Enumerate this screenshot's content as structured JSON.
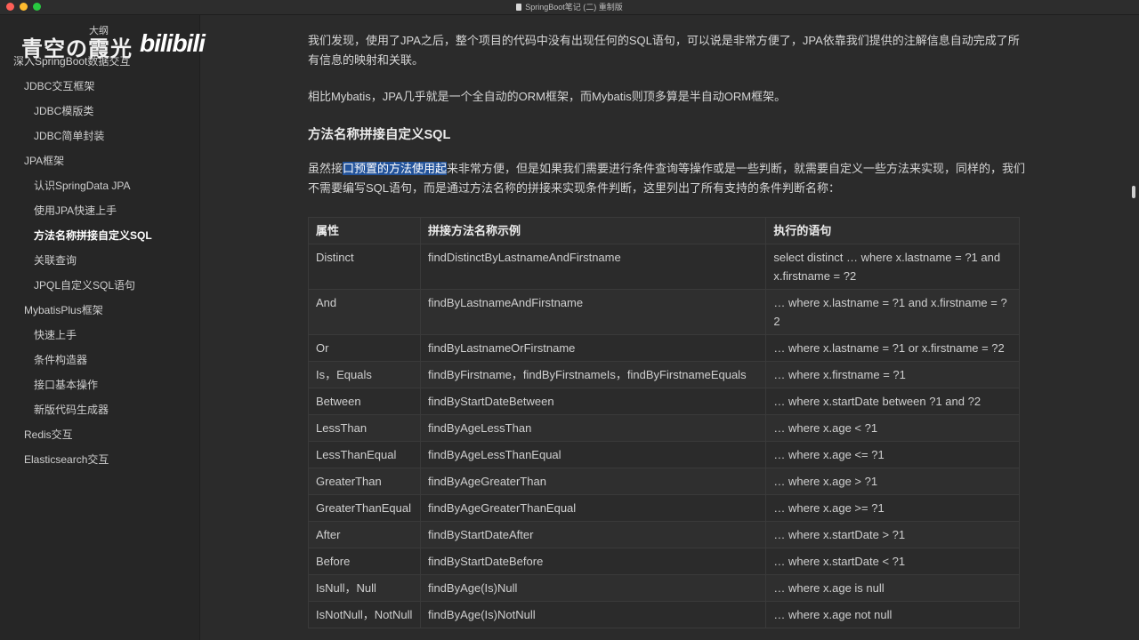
{
  "window": {
    "title": "SpringBoot笔记 (二) 重制版"
  },
  "sidebar": {
    "outline_label": "大纲",
    "watermark_text": "青空の霞光",
    "watermark_logo": "bilibili",
    "items": [
      {
        "label": "深入SpringBoot数据交互",
        "level": 1
      },
      {
        "label": "JDBC交互框架",
        "level": 2
      },
      {
        "label": "JDBC模版类",
        "level": 3
      },
      {
        "label": "JDBC简单封装",
        "level": 3
      },
      {
        "label": "JPA框架",
        "level": 2
      },
      {
        "label": "认识SpringData JPA",
        "level": 3
      },
      {
        "label": "使用JPA快速上手",
        "level": 3
      },
      {
        "label": "方法名称拼接自定义SQL",
        "level": 3,
        "active": true
      },
      {
        "label": "关联查询",
        "level": 3
      },
      {
        "label": "JPQL自定义SQL语句",
        "level": 3
      },
      {
        "label": "MybatisPlus框架",
        "level": 2
      },
      {
        "label": "快速上手",
        "level": 3
      },
      {
        "label": "条件构造器",
        "level": 3
      },
      {
        "label": "接口基本操作",
        "level": 3
      },
      {
        "label": "新版代码生成器",
        "level": 3
      },
      {
        "label": "Redis交互",
        "level": 2
      },
      {
        "label": "Elasticsearch交互",
        "level": 2
      }
    ]
  },
  "content": {
    "p1": "我们发现，使用了JPA之后，整个项目的代码中没有出现任何的SQL语句，可以说是非常方便了，JPA依靠我们提供的注解信息自动完成了所有信息的映射和关联。",
    "p2": "相比Mybatis，JPA几乎就是一个全自动的ORM框架，而Mybatis则顶多算是半自动ORM框架。",
    "heading": "方法名称拼接自定义SQL",
    "p3_before": "虽然接",
    "p3_highlight": "口预置的方法使用起",
    "p3_after": "来非常方便，但是如果我们需要进行条件查询等操作或是一些判断，就需要自定义一些方法来实现，同样的，我们不需要编写SQL语句，而是通过方法名称的拼接来实现条件判断，这里列出了所有支持的条件判断名称：",
    "table": {
      "headers": [
        "属性",
        "拼接方法名称示例",
        "执行的语句"
      ],
      "rows": [
        [
          "Distinct",
          "findDistinctByLastnameAndFirstname",
          "select distinct … where x.lastname = ?1 and x.firstname = ?2"
        ],
        [
          "And",
          "findByLastnameAndFirstname",
          "… where x.lastname = ?1 and x.firstname = ?2"
        ],
        [
          "Or",
          "findByLastnameOrFirstname",
          "… where x.lastname = ?1 or x.firstname = ?2"
        ],
        [
          "Is，Equals",
          "findByFirstname，findByFirstnameIs，findByFirstnameEquals",
          "… where x.firstname = ?1"
        ],
        [
          "Between",
          "findByStartDateBetween",
          "… where x.startDate between ?1 and ?2"
        ],
        [
          "LessThan",
          "findByAgeLessThan",
          "… where x.age < ?1"
        ],
        [
          "LessThanEqual",
          "findByAgeLessThanEqual",
          "… where x.age <= ?1"
        ],
        [
          "GreaterThan",
          "findByAgeGreaterThan",
          "… where x.age > ?1"
        ],
        [
          "GreaterThanEqual",
          "findByAgeGreaterThanEqual",
          "… where x.age >= ?1"
        ],
        [
          "After",
          "findByStartDateAfter",
          "… where x.startDate > ?1"
        ],
        [
          "Before",
          "findByStartDateBefore",
          "… where x.startDate < ?1"
        ],
        [
          "IsNull，Null",
          "findByAge(Is)Null",
          "… where x.age is null"
        ],
        [
          "IsNotNull，NotNull",
          "findByAge(Is)NotNull",
          "… where x.age not null"
        ]
      ]
    }
  }
}
